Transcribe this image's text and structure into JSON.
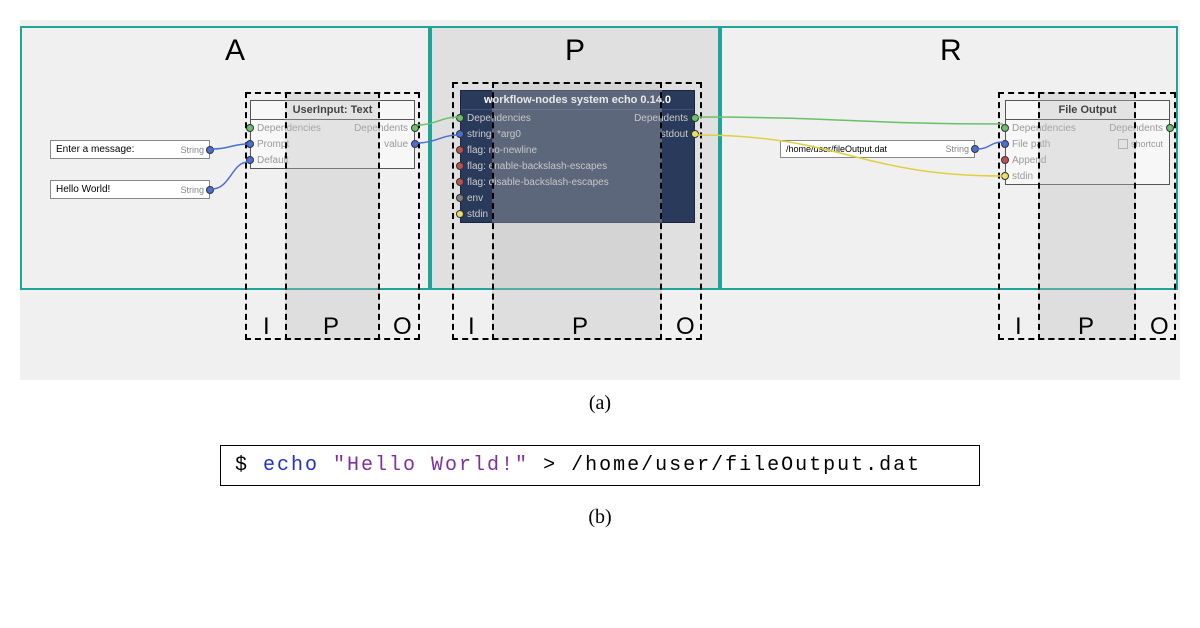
{
  "sections": {
    "A": "A",
    "P": "P",
    "R": "R"
  },
  "ipo": {
    "I": "I",
    "P": "P",
    "O": "O"
  },
  "inputs": {
    "msg_prompt": "Enter a message:",
    "msg_value": "Hello World!",
    "file_path": "/home/user/fileOutput.dat",
    "type_string": "String"
  },
  "userInput": {
    "title": "UserInput: Text",
    "deps": "Dependencies",
    "dependents": "Dependents",
    "prompt": "Prompt",
    "value": "value",
    "default": "Default"
  },
  "echo": {
    "title": "workflow-nodes system echo 0.14.0",
    "deps": "Dependencies",
    "dependents": "Dependents",
    "string": "string: *arg0",
    "flag1": "flag: no-newline",
    "flag2": "flag: enable-backslash-escapes",
    "flag3": "flag: disable-backslash-escapes",
    "env": "env",
    "stdin": "stdin",
    "stdout": "stdout"
  },
  "fileOut": {
    "title": "File Output",
    "deps": "Dependencies",
    "dependents": "Dependents",
    "filepath": "File path",
    "append": "Append",
    "stdin": "stdin",
    "shortcut": "shortcut"
  },
  "captions": {
    "a": "(a)",
    "b": "(b)"
  },
  "command": {
    "prompt": "$ ",
    "cmd": "echo",
    "str": " \"Hello World!\" ",
    "rest": "> /home/user/fileOutput.dat"
  }
}
